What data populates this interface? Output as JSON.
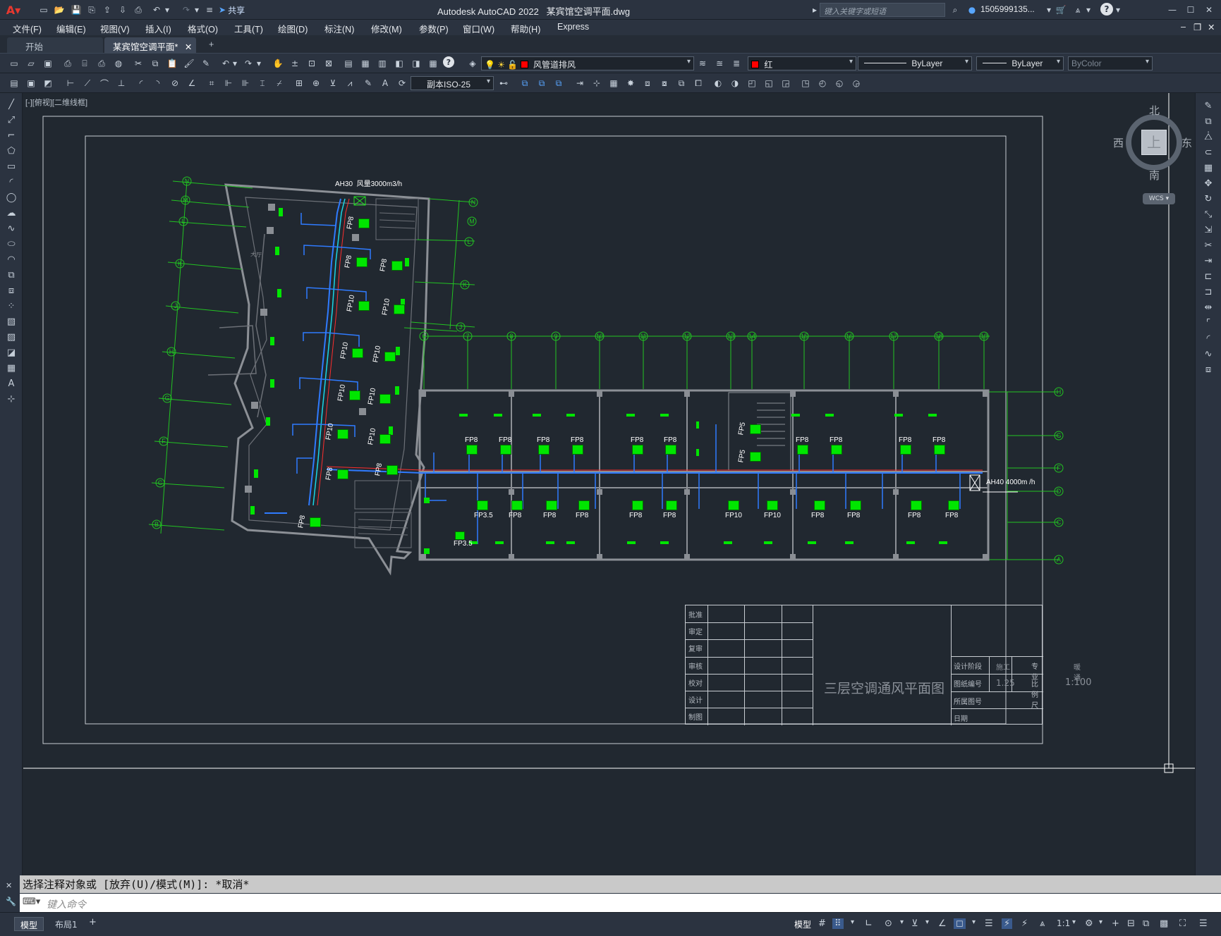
{
  "window": {
    "app_title": "Autodesk AutoCAD 2022",
    "file_name": "某宾馆空调平面.dwg",
    "share_label": "共享",
    "search_placeholder": "键入关键字或短语",
    "user": "1505999135...",
    "help": "?"
  },
  "menu": [
    "文件(F)",
    "编辑(E)",
    "视图(V)",
    "插入(I)",
    "格式(O)",
    "工具(T)",
    "绘图(D)",
    "标注(N)",
    "修改(M)",
    "参数(P)",
    "窗口(W)",
    "帮助(H)",
    "Express"
  ],
  "tabs": {
    "start": "开始",
    "drawing": "某宾馆空调平面*",
    "add": "+"
  },
  "properties": {
    "layer": "风管道排风",
    "color": "红",
    "color_hex": "#ff0000",
    "layer_swatch_hex": "#ff0000",
    "linetype": "ByLayer",
    "lineweight": "ByLayer",
    "plotstyle": "ByColor",
    "dimstyle": "副本ISO-25"
  },
  "viewport": {
    "label": "[-][俯视][二维线框]",
    "viewcube": {
      "north": "北",
      "south": "南",
      "east": "东",
      "west": "西",
      "top": "上",
      "wcs": "WCS"
    }
  },
  "drawing": {
    "ah30": "AH30",
    "ah30_flow": "风量3000m3/h",
    "ah40": "AH40",
    "ah40_flow": "4000m",
    "ah40_unit": "/h",
    "left_units": [
      {
        "label": "FP8"
      },
      {
        "label": "FP8"
      },
      {
        "label": "FP8"
      },
      {
        "label": "FP10"
      },
      {
        "label": "FP10"
      },
      {
        "label": "FP10"
      },
      {
        "label": "FP10"
      },
      {
        "label": "FP10"
      },
      {
        "label": "FP10"
      },
      {
        "label": "FP10"
      },
      {
        "label": "FP10"
      },
      {
        "label": "FP8"
      },
      {
        "label": "FP8"
      },
      {
        "label": "FP8"
      }
    ],
    "upper_row": [
      "FP8",
      "FP8",
      "FP8",
      "FP8",
      "FP8",
      "FP8",
      "FP5",
      "FP5",
      "FP8",
      "FP8",
      "FP8",
      "FP8"
    ],
    "lower_row": [
      "FP3.5",
      "FP8",
      "FP8",
      "FP8",
      "FP8",
      "FP8",
      "FP10",
      "FP10",
      "FP8",
      "FP8",
      "FP8",
      "FP8"
    ],
    "lower_extra": "FP3.5",
    "axis_left": [
      "N",
      "M",
      "L",
      "K",
      "J",
      "H",
      "G",
      "F",
      "C",
      "B"
    ],
    "axis_top": [
      "6",
      "7",
      "8",
      "9",
      "10",
      "11",
      "12",
      "13",
      "14",
      "15",
      "16",
      "17",
      "18",
      "19"
    ],
    "axis_right": [
      "H",
      "G",
      "F",
      "D",
      "C",
      "A"
    ],
    "axis_left_mid": [
      "N",
      "M",
      "L",
      "K",
      "J"
    ],
    "room_label": "大厅"
  },
  "title_block": {
    "roles": [
      "批准",
      "审定",
      "复审",
      "审核",
      "校对",
      "设计",
      "制图"
    ],
    "design_stage_label": "设计阶段",
    "design_stage_value": "施工",
    "discipline_label": "专 业",
    "discipline_value": "暖通",
    "drawing_no_label": "图纸编号",
    "drawing_no_value": "1.25",
    "scale_label": "比例尺",
    "scale_value": "1:100",
    "sheet_label": "所属图号",
    "date_label": "日期",
    "drawing_title": "三层空调通风平面图"
  },
  "command": {
    "history": "选择注释对象或 [放弃(U)/模式(M)]: *取消*",
    "placeholder": "键入命令"
  },
  "status": {
    "model_tab": "模型",
    "layout_tab": "布局1",
    "add": "+",
    "model_button": "模型",
    "scale": "1:1"
  }
}
